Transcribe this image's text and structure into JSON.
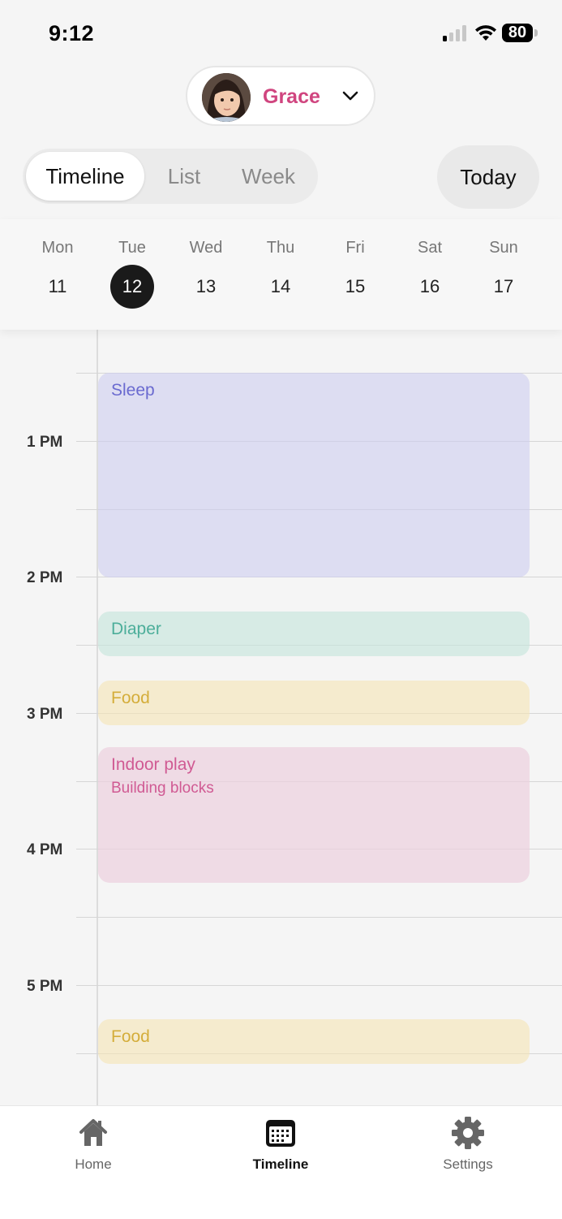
{
  "status_bar": {
    "time": "9:12",
    "battery": "80"
  },
  "child_picker": {
    "name": "Grace"
  },
  "view_switch": {
    "tabs": [
      "Timeline",
      "List",
      "Week"
    ],
    "active": "Timeline",
    "today_label": "Today"
  },
  "week": {
    "days": [
      {
        "name": "Mon",
        "num": "11"
      },
      {
        "name": "Tue",
        "num": "12"
      },
      {
        "name": "Wed",
        "num": "13"
      },
      {
        "name": "Thu",
        "num": "14"
      },
      {
        "name": "Fri",
        "num": "15"
      },
      {
        "name": "Sat",
        "num": "16"
      },
      {
        "name": "Sun",
        "num": "17"
      }
    ],
    "selected": "12"
  },
  "timeline": {
    "hours": [
      "1 PM",
      "2 PM",
      "3 PM",
      "4 PM",
      "5 PM"
    ],
    "events": [
      {
        "type": "sleep",
        "title": "Sleep",
        "subtitle": ""
      },
      {
        "type": "diaper",
        "title": "Diaper",
        "subtitle": ""
      },
      {
        "type": "food",
        "title": "Food",
        "subtitle": ""
      },
      {
        "type": "play",
        "title": "Indoor play",
        "subtitle": "Building blocks"
      },
      {
        "type": "food",
        "title": "Food",
        "subtitle": ""
      }
    ]
  },
  "tab_bar": {
    "items": [
      {
        "label": "Home",
        "icon": "home-icon"
      },
      {
        "label": "Timeline",
        "icon": "calendar-icon"
      },
      {
        "label": "Settings",
        "icon": "gear-icon"
      }
    ],
    "active": "Timeline"
  }
}
